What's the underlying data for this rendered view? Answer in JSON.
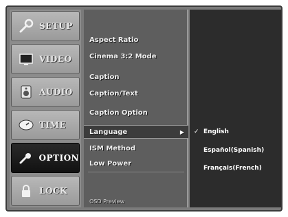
{
  "tabs": [
    {
      "label": "SETUP",
      "icon": "wrench-icon"
    },
    {
      "label": "VIDEO",
      "icon": "tv-icon"
    },
    {
      "label": "AUDIO",
      "icon": "speaker-icon"
    },
    {
      "label": "TIME",
      "icon": "clock-icon"
    },
    {
      "label": "OPTION",
      "icon": "option-icon",
      "active": true
    },
    {
      "label": "LOCK",
      "icon": "lock-icon"
    }
  ],
  "menu": {
    "items": [
      {
        "label": "Aspect Ratio"
      },
      {
        "label": "Cinema 3:2 Mode"
      },
      {
        "label": "Caption"
      },
      {
        "label": "Caption/Text"
      },
      {
        "label": "Caption Option"
      },
      {
        "label": "Language",
        "selected": true,
        "arrow": "▶"
      },
      {
        "label": "ISM Method"
      },
      {
        "label": "Low Power"
      },
      {
        "label": "OSD Preview"
      }
    ]
  },
  "options": {
    "items": [
      {
        "label": "English",
        "checked": true,
        "check": "✓"
      },
      {
        "label": "Español(Spanish)",
        "checked": false,
        "check": ""
      },
      {
        "label": "Français(French)",
        "checked": false,
        "check": ""
      }
    ]
  }
}
